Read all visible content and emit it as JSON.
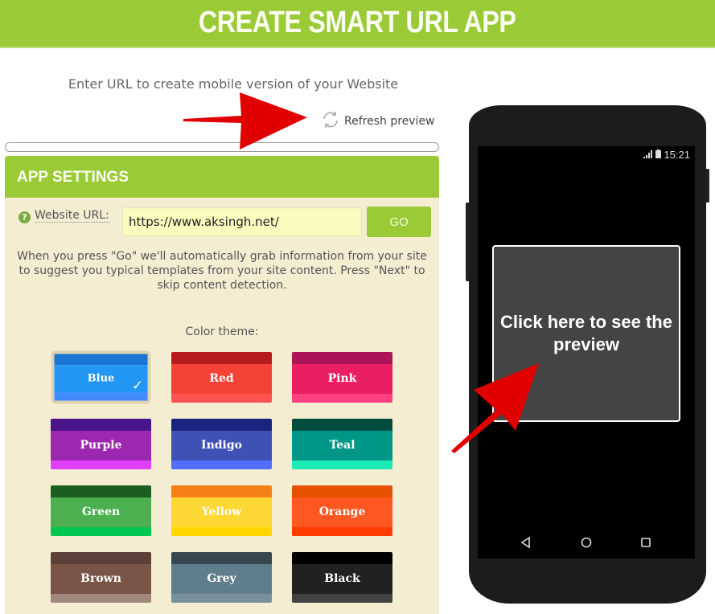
{
  "header": {
    "title": "CREATE SMART URL APP"
  },
  "subtitle": "Enter URL to create mobile version of your Website",
  "refresh": {
    "label": "Refresh preview",
    "icon": "refresh-icon"
  },
  "progress": {
    "value": 0
  },
  "settings": {
    "title": "APP SETTINGS",
    "url_label": "Website URL:",
    "help_icon": "?",
    "url_value": "https://www.aksingh.net/",
    "go_label": "GO",
    "hint": "When you press \"Go\" we'll automatically grab information from your site to suggest you typical templates from your site content. Press \"Next\" to skip content detection.",
    "theme_label": "Color theme:",
    "selected_theme": "Blue",
    "check_icon": "✓",
    "themes": [
      {
        "name": "Blue",
        "top": "#1976d2",
        "mid": "#2196f3",
        "bot": "#448aff"
      },
      {
        "name": "Red",
        "top": "#b71c1c",
        "mid": "#f44336",
        "bot": "#ff5252"
      },
      {
        "name": "Pink",
        "top": "#ad1457",
        "mid": "#e91e63",
        "bot": "#ff4081"
      },
      {
        "name": "Purple",
        "top": "#4a148c",
        "mid": "#9c27b0",
        "bot": "#e040fb"
      },
      {
        "name": "Indigo",
        "top": "#1a237e",
        "mid": "#3f51b5",
        "bot": "#536dfe"
      },
      {
        "name": "Teal",
        "top": "#004d40",
        "mid": "#009688",
        "bot": "#1de9b6"
      },
      {
        "name": "Green",
        "top": "#1b5e20",
        "mid": "#4caf50",
        "bot": "#00c853"
      },
      {
        "name": "Yellow",
        "top": "#f57f17",
        "mid": "#fdd835",
        "bot": "#ffd600"
      },
      {
        "name": "Orange",
        "top": "#e65100",
        "mid": "#ff5722",
        "bot": "#ff3d00"
      },
      {
        "name": "Brown",
        "top": "#5d4037",
        "mid": "#795548",
        "bot": "#a1887f"
      },
      {
        "name": "Grey",
        "top": "#37474f",
        "mid": "#607d8b",
        "bot": "#78909c"
      },
      {
        "name": "Black",
        "top": "#000000",
        "mid": "#212121",
        "bot": "#424242"
      }
    ]
  },
  "phone": {
    "time": "15:21",
    "preview_label": "Click here to see the preview",
    "nav": [
      "back-icon",
      "home-icon",
      "recents-icon"
    ]
  },
  "annotations": {
    "arrow_color": "#e00000"
  }
}
